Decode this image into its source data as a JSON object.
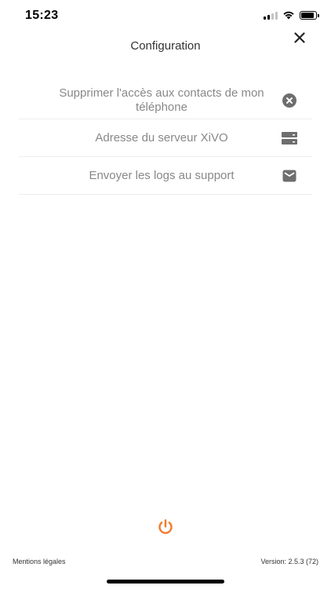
{
  "status_bar": {
    "time": "15:23",
    "icons": [
      "signal-icon",
      "wifi-icon",
      "battery-icon"
    ]
  },
  "header": {
    "title": "Configuration",
    "close_icon": "close-icon"
  },
  "menu": {
    "items": [
      {
        "label": "Supprimer l'accès aux contacts de mon téléphone",
        "icon": "remove-circle-icon"
      },
      {
        "label": "Adresse du serveur XiVO",
        "icon": "server-icon"
      },
      {
        "label": "Envoyer les logs au support",
        "icon": "mail-icon"
      }
    ]
  },
  "power": {
    "icon": "power-icon",
    "color": "#f07a2b"
  },
  "footer": {
    "legal_link": "Mentions légales",
    "version": "Version: 2.5.3 (72)"
  },
  "colors": {
    "icon_gray": "#6e6e6e",
    "label_gray": "#888888",
    "divider": "#eeeeee"
  }
}
